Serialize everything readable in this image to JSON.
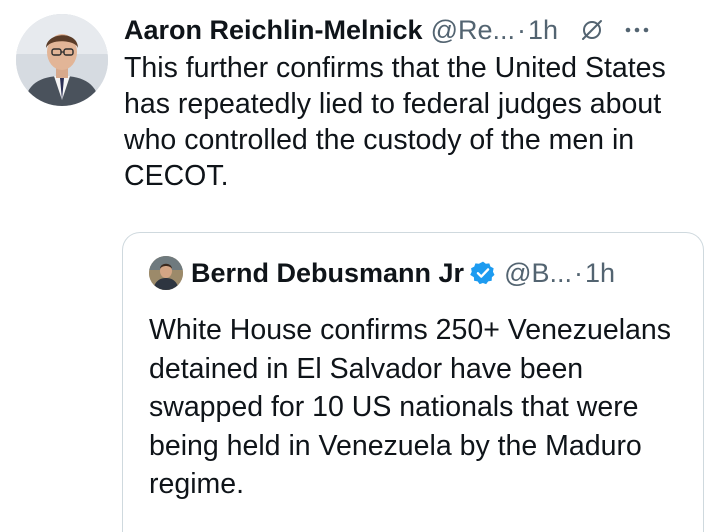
{
  "tweet": {
    "author_name": "Aaron Reichlin-Melnick",
    "handle": "@Re...",
    "separator": "·",
    "time": "1h",
    "text": "This further confirms that the United States has repeatedly lied to federal judges about who controlled the custody of the men in CECOT.",
    "icons": {
      "grok": "grok-icon",
      "more": "more-icon"
    }
  },
  "quote": {
    "author_name": "Bernd Debusmann Jr",
    "handle": "@B...",
    "separator": "·",
    "time": "1h",
    "text": "White House confirms 250+ Venezuelans detained in El Salvador have been swapped for 10 US nationals that were being held in Venezuela by the Maduro regime.",
    "icons": {
      "verified": "verified-badge-icon"
    }
  },
  "colors": {
    "text": "#0f1419",
    "secondary": "#536471",
    "border": "#cfd9de",
    "verified": "#1d9bf0"
  }
}
